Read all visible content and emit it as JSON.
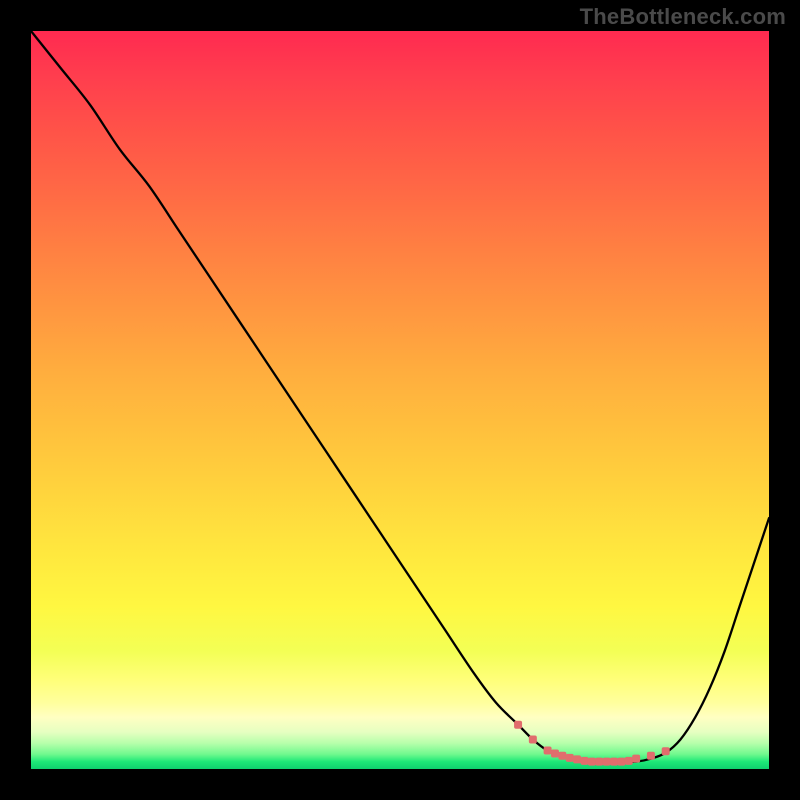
{
  "attribution": "TheBottleneck.com",
  "colors": {
    "background": "#000000",
    "curve": "#000000",
    "marker": "#e16d6d"
  },
  "chart_data": {
    "type": "line",
    "title": "",
    "xlabel": "",
    "ylabel": "",
    "xlim": [
      0,
      100
    ],
    "ylim": [
      0,
      100
    ],
    "grid": false,
    "legend": false,
    "series": [
      {
        "name": "bottleneck_curve",
        "x": [
          0,
          4,
          8,
          12,
          16,
          20,
          24,
          28,
          32,
          36,
          40,
          44,
          48,
          52,
          56,
          60,
          63,
          66,
          68,
          70,
          72,
          74,
          76,
          78,
          80,
          82,
          84,
          86,
          88,
          90,
          92,
          94,
          96,
          98,
          100
        ],
        "y": [
          100,
          95,
          90,
          84,
          79,
          73,
          67,
          61,
          55,
          49,
          43,
          37,
          31,
          25,
          19,
          13,
          9,
          6,
          4,
          2.5,
          1.8,
          1.3,
          1,
          1,
          1,
          1,
          1.4,
          2.2,
          4,
          7,
          11,
          16,
          22,
          28,
          34
        ]
      }
    ],
    "optimal_markers_x": [
      66,
      68,
      70,
      71,
      72,
      73,
      74,
      75,
      76,
      77,
      78,
      79,
      80,
      81,
      82,
      84,
      86
    ],
    "optimal_markers_y": [
      6,
      4,
      2.5,
      2.1,
      1.8,
      1.5,
      1.3,
      1.1,
      1,
      1,
      1,
      1,
      1,
      1.1,
      1.4,
      1.8,
      2.4
    ]
  }
}
